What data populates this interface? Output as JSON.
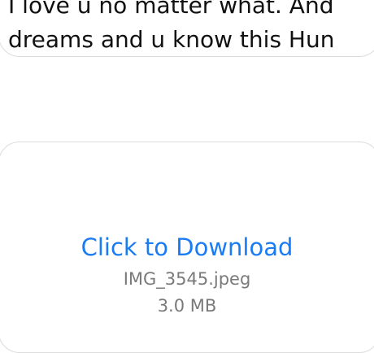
{
  "message": {
    "line1": "I love u no matter what. And",
    "line2": "dreams and u know this Hun"
  },
  "attachment": {
    "download_label": "Click to Download",
    "file_name": "IMG_3545.jpeg",
    "file_size": "3.0 MB"
  },
  "colors": {
    "link": "#1a7cf4",
    "meta_text": "#7a7a7a",
    "bubble_border": "#dcdcdc"
  }
}
